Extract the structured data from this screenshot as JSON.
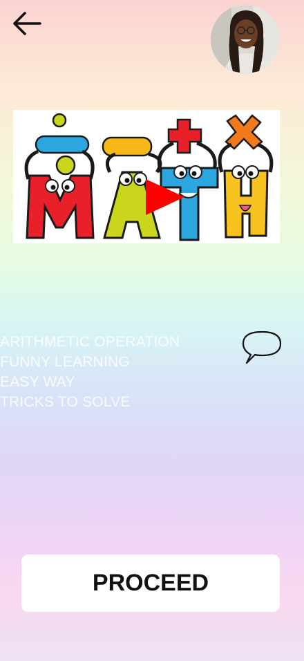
{
  "header": {
    "back_icon": "arrow-left-icon",
    "avatar_icon": "user-avatar-photo"
  },
  "video": {
    "thumbnail_text": "MATH",
    "symbols": [
      "÷",
      "−",
      "+",
      "×"
    ],
    "play_icon": "play-icon",
    "letter_colors": [
      "#e8202a",
      "#c9d61b",
      "#2ba6df",
      "#f7c21e"
    ]
  },
  "topics": {
    "items": [
      "ARITHMETIC OPERATION",
      "FUNNY LEARNING",
      "EASY WAY",
      "TRICKS TO SOLVE"
    ],
    "chat_icon": "speech-bubble-icon"
  },
  "footer": {
    "proceed_label": "PROCEED"
  }
}
